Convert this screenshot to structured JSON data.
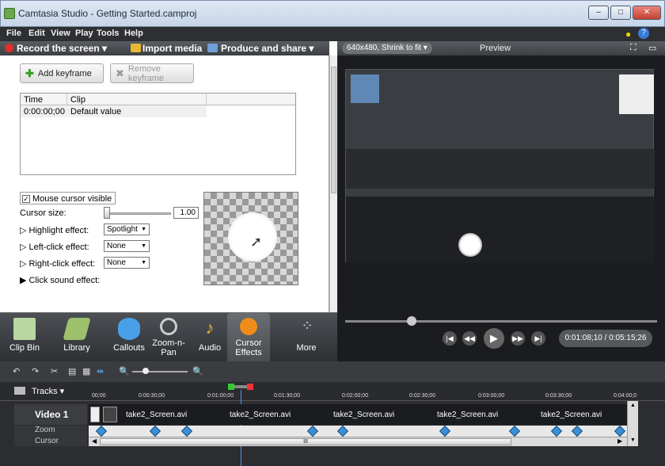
{
  "window": {
    "title": "Camtasia Studio - Getting Started.camproj",
    "buttons": [
      "–",
      "□",
      "✕"
    ]
  },
  "menu": [
    "File",
    "Edit",
    "View",
    "Play",
    "Tools",
    "Help"
  ],
  "toolbar": {
    "record": "Record the screen ▾",
    "import": "Import media",
    "produce": "Produce and share ▾"
  },
  "keyframes": {
    "add": "Add keyframe",
    "remove": "Remove keyframe",
    "columns": [
      "Time",
      "Clip"
    ],
    "rows": [
      {
        "time": "0:00:00;00",
        "clip": "Default value"
      }
    ]
  },
  "cursor": {
    "visible_label": "Mouse cursor visible",
    "visible_checked": true,
    "size_label": "Cursor size:",
    "size_value": "1.00",
    "highlight_label": "Highlight effect:",
    "highlight_value": "Spotlight",
    "left_label": "Left-click effect:",
    "left_value": "None",
    "right_label": "Right-click effect:",
    "right_value": "None",
    "sound_label": "Click sound effect:"
  },
  "tabs": [
    {
      "label": "Clip Bin",
      "icon": "clip-bin-icon"
    },
    {
      "label": "Library",
      "icon": "library-icon"
    },
    {
      "label": "Callouts",
      "icon": "callouts-icon"
    },
    {
      "label": "Zoom-n-Pan",
      "icon": "zoom-icon"
    },
    {
      "label": "Audio",
      "icon": "audio-icon"
    },
    {
      "label": "Cursor Effects",
      "icon": "cursor-effects-icon"
    },
    {
      "label": "More",
      "icon": "more-icon"
    }
  ],
  "preview": {
    "size": "640x480, Shrink to fit",
    "title": "Preview",
    "time": "0:01:08;10 / 0:05:15;26"
  },
  "timeline": {
    "tracks_label": "Tracks",
    "ticks": [
      "00;00",
      "0:00:30;00",
      "0:01:00;00",
      "0:01:30;00",
      "0:02:00;00",
      "0:02:30;00",
      "0:03:00;00",
      "0:03:30;00",
      "0:04:00;0"
    ],
    "video_label": "Video 1",
    "zoom_label": "Zoom",
    "cursor_label": "Cursor",
    "clips": [
      "take2_Screen.avi",
      "take2_Screen.avi",
      "take2_Screen.avi",
      "take2_Screen.avi",
      "take2_Screen.avi"
    ],
    "scroll_mid": "III"
  },
  "colors": {
    "accent": "#f08c1a",
    "dark": "#2c2d31",
    "keyframe": "#3a8fd6"
  }
}
